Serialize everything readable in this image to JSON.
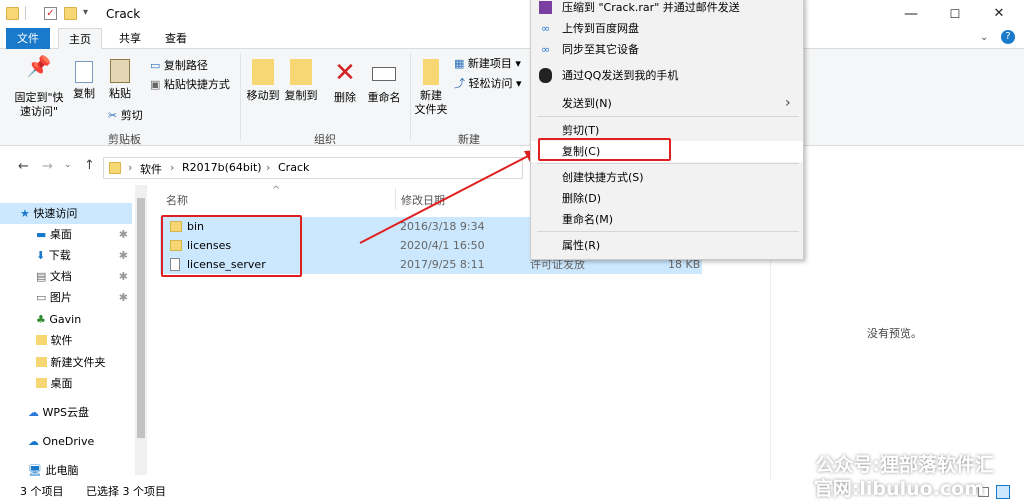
{
  "window": {
    "title": "Crack",
    "controls": [
      "—",
      "☐",
      "✕"
    ]
  },
  "tabs": [
    {
      "label": "文件"
    },
    {
      "label": "主页"
    },
    {
      "label": "共享"
    },
    {
      "label": "查看"
    }
  ],
  "ribbon": {
    "clipboard": {
      "pin_label": "固定到\"快速访问\"",
      "copy_label": "复制",
      "paste_label": "粘贴",
      "copy_path": "复制路径",
      "paste_shortcut": "粘贴快捷方式",
      "cut": "剪切",
      "group": "剪贴板"
    },
    "organize": {
      "move_to": "移动到",
      "copy_to": "复制到",
      "delete": "删除",
      "rename": "重命名",
      "group": "组织"
    },
    "new": {
      "new_folder": "新建\n文件夹",
      "new_item": "新建项目 ▾",
      "easy_access": "轻松访问 ▾",
      "group": "新建"
    }
  },
  "breadcrumb": [
    "软件",
    "R2017b(64bit)",
    "Crack"
  ],
  "nav": [
    {
      "label": "快速访问",
      "icon": "star-icon"
    },
    {
      "label": "桌面",
      "icon": "desktop-icon"
    },
    {
      "label": "下载",
      "icon": "download-icon"
    },
    {
      "label": "文档",
      "icon": "document-icon"
    },
    {
      "label": "图片",
      "icon": "picture-icon"
    },
    {
      "label": "Gavin",
      "icon": "user-tree-icon"
    },
    {
      "label": "软件",
      "icon": "folder-icon"
    },
    {
      "label": "新建文件夹",
      "icon": "folder-icon"
    },
    {
      "label": "桌面",
      "icon": "folder-icon"
    },
    {
      "label": "WPS云盘",
      "icon": "cloud-icon"
    },
    {
      "label": "OneDrive",
      "icon": "onedrive-icon"
    },
    {
      "label": "此电脑",
      "icon": "computer-icon"
    }
  ],
  "columns": {
    "name": "名称",
    "modified": "修改日期"
  },
  "files": [
    {
      "name": "bin",
      "date": "2016/3/18 9:34",
      "type": "",
      "size": ""
    },
    {
      "name": "licenses",
      "date": "2020/4/1 16:50",
      "type": "",
      "size": ""
    },
    {
      "name": "license_server",
      "date": "2017/9/25 8:11",
      "type": "许可证发放",
      "size": "18 KB"
    }
  ],
  "preview": {
    "text": "没有预览。"
  },
  "status": {
    "count": "3 个项目",
    "selected": "已选择 3 个项目"
  },
  "context_menu": {
    "compress": "压缩到 \"Crack.rar\" 并通过邮件发送",
    "upload_baidu": "上传到百度网盘",
    "sync_devices": "同步至其它设备",
    "qq_send": "通过QQ发送到我的手机",
    "send_to": "发送到(N)",
    "cut": "剪切(T)",
    "copy": "复制(C)",
    "shortcut": "创建快捷方式(S)",
    "delete": "删除(D)",
    "rename": "重命名(M)",
    "properties": "属性(R)"
  },
  "watermark": {
    "line1": "公众号:狸部落软件汇",
    "line2": "官网:libuluo.com"
  },
  "colors": {
    "accent": "#1979ca",
    "selection": "#cce8ff",
    "annotation": "#e02020"
  }
}
